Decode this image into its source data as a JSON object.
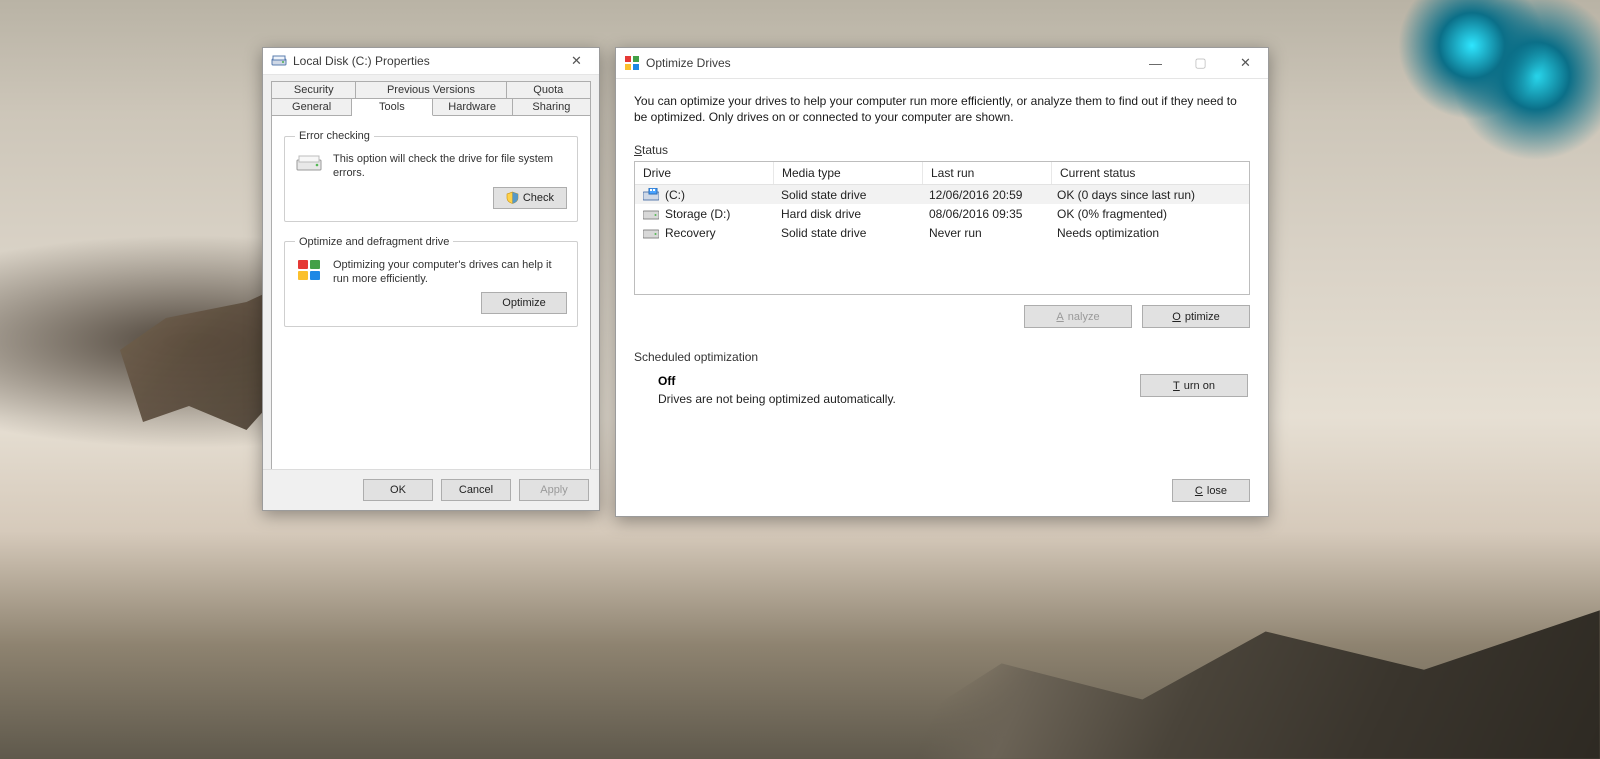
{
  "properties": {
    "title": "Local Disk (C:) Properties",
    "tabs_row1": [
      "Security",
      "Previous Versions",
      "Quota"
    ],
    "tabs_row2": [
      "General",
      "Tools",
      "Hardware",
      "Sharing"
    ],
    "active_tab": "Tools",
    "error_checking": {
      "legend": "Error checking",
      "text": "This option will check the drive for file system errors.",
      "button": "Check"
    },
    "optimize_group": {
      "legend": "Optimize and defragment drive",
      "text": "Optimizing your computer's drives can help it run more efficiently.",
      "button": "Optimize"
    },
    "footer": {
      "ok": "OK",
      "cancel": "Cancel",
      "apply": "Apply"
    }
  },
  "optimize": {
    "title": "Optimize Drives",
    "description": "You can optimize your drives to help your computer run more efficiently, or analyze them to find out if they need to be optimized. Only drives on or connected to your computer are shown.",
    "status_label": "Status",
    "columns": {
      "drive": "Drive",
      "media": "Media type",
      "last": "Last run",
      "status": "Current status"
    },
    "rows": [
      {
        "name": "(C:)",
        "icon": "os-drive",
        "media": "Solid state drive",
        "last": "12/06/2016 20:59",
        "status": "OK (0 days since last run)"
      },
      {
        "name": "Storage (D:)",
        "icon": "hdd-drive",
        "media": "Hard disk drive",
        "last": "08/06/2016 09:35",
        "status": "OK (0% fragmented)"
      },
      {
        "name": "Recovery",
        "icon": "hdd-drive",
        "media": "Solid state drive",
        "last": "Never run",
        "status": "Needs optimization"
      }
    ],
    "analyze_button": "Analyze",
    "optimize_button": "Optimize",
    "sched_label": "Scheduled optimization",
    "sched_status": "Off",
    "sched_desc": "Drives are not being optimized automatically.",
    "turn_on_button": "Turn on",
    "close_button": "Close"
  }
}
